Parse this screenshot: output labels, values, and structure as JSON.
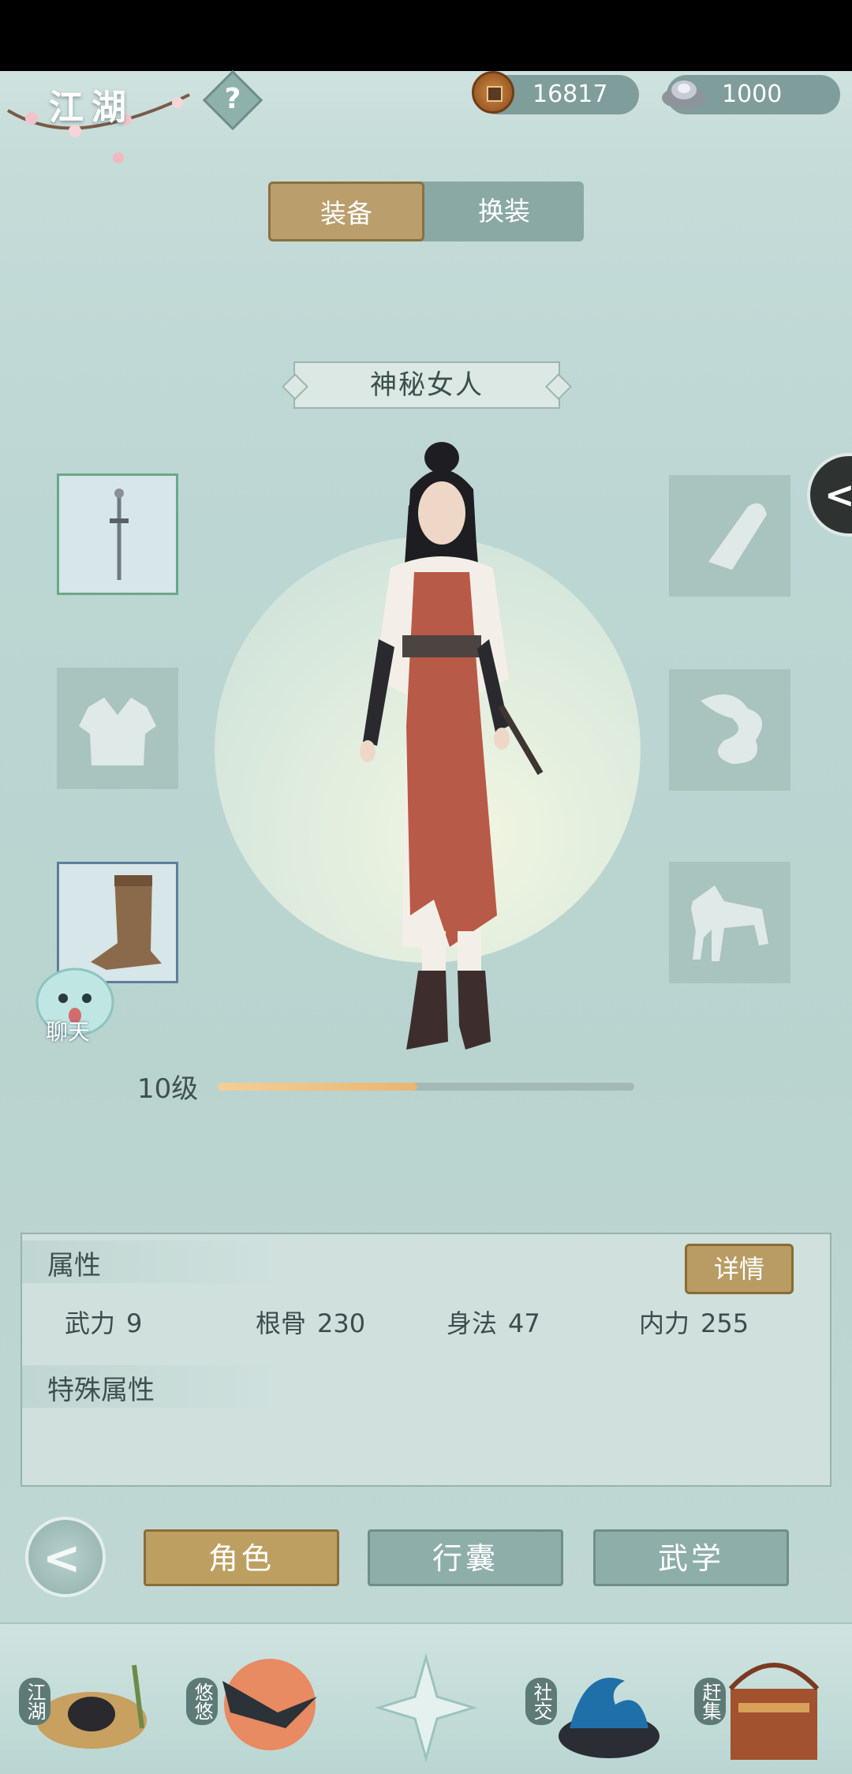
{
  "header": {
    "title": "江湖",
    "help_icon": "question-mark-icon",
    "copper_amount": "16817",
    "silver_amount": "1000"
  },
  "top_tabs": [
    {
      "label": "装备",
      "active": true
    },
    {
      "label": "换装",
      "active": false
    }
  ],
  "character": {
    "name": "神秘女人",
    "level_label": "10级",
    "xp_progress": 0.48
  },
  "slots_left": [
    {
      "name": "weapon",
      "icon": "sword-icon",
      "filled": true
    },
    {
      "name": "armor",
      "icon": "robe-icon",
      "filled": false
    },
    {
      "name": "boots",
      "icon": "boot-icon",
      "filled": true
    }
  ],
  "slots_right": [
    {
      "name": "accessory",
      "icon": "bracer-icon",
      "filled": false
    },
    {
      "name": "trinket",
      "icon": "cloud-swirl-icon",
      "filled": false
    },
    {
      "name": "mount",
      "icon": "horse-icon",
      "filled": false
    }
  ],
  "chat": {
    "label": "聊天"
  },
  "attributes": {
    "title": "属性",
    "detail_button": "详情",
    "items": [
      {
        "label": "武力",
        "value": "9"
      },
      {
        "label": "根骨",
        "value": "230"
      },
      {
        "label": "身法",
        "value": "47"
      },
      {
        "label": "内力",
        "value": "255"
      }
    ],
    "special_title": "特殊属性"
  },
  "bottom_tabs": [
    {
      "label": "角色",
      "active": true
    },
    {
      "label": "行囊",
      "active": false
    },
    {
      "label": "武学",
      "active": false
    }
  ],
  "dock": [
    {
      "label": "江湖",
      "icon": "bamboo-hat-icon"
    },
    {
      "label": "悠悠",
      "icon": "swallow-icon"
    },
    {
      "label": "",
      "icon": "four-point-star-icon"
    },
    {
      "label": "社交",
      "icon": "wave-bowl-icon"
    },
    {
      "label": "赶集",
      "icon": "market-basket-icon"
    }
  ],
  "colors": {
    "gold_active": "#bd9f62",
    "teal_inactive": "#8eaea9",
    "background": "#bcd6d3"
  }
}
